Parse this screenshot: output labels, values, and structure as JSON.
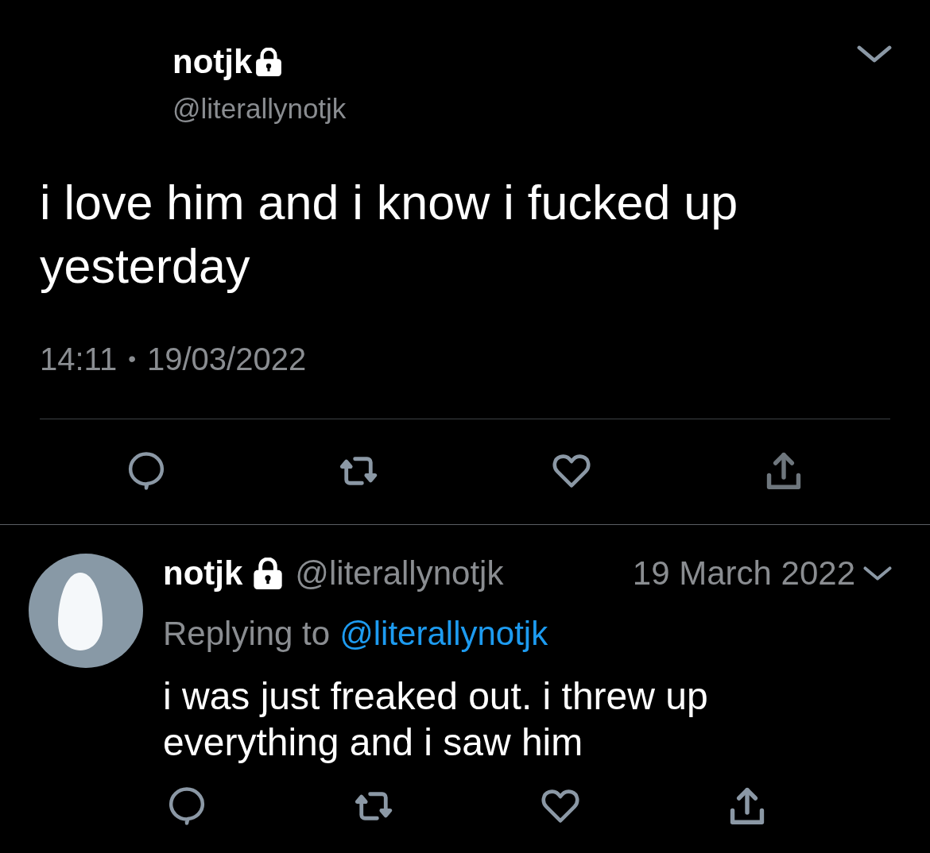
{
  "main_tweet": {
    "display_name": "notjk",
    "locked": true,
    "handle": "@literallynotjk",
    "text": "i love him and i know i fucked up yesterday",
    "time": "14:11",
    "separator": "•",
    "date": "19/03/2022"
  },
  "reply": {
    "display_name": "notjk",
    "locked": true,
    "handle": "@literallynotjk",
    "date": "19 March 2022",
    "replying_label": "Replying to",
    "replying_handle": "@literallynotjk",
    "text": "i was just freaked out. i threw up everything and i saw him"
  }
}
